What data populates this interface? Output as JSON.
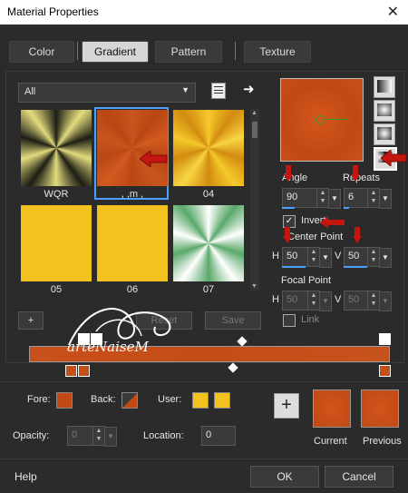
{
  "window": {
    "title": "Material Properties",
    "close": "✕"
  },
  "tabs": [
    {
      "label": "Color",
      "active": false
    },
    {
      "label": "Gradient",
      "active": true
    },
    {
      "label": "Pattern",
      "active": false
    },
    {
      "label": "Texture",
      "active": false
    }
  ],
  "filter": {
    "value": "All"
  },
  "gradients": [
    {
      "label": "WQR"
    },
    {
      "label": ", ,m ,"
    },
    {
      "label": "04"
    },
    {
      "label": "05"
    },
    {
      "label": "06"
    },
    {
      "label": "07"
    }
  ],
  "params": {
    "angle_label": "Angle",
    "angle_value": "90",
    "repeats_label": "Repeats",
    "repeats_value": "6",
    "invert_label": "Invert",
    "invert_checked": true,
    "center_point_label": "Center Point",
    "center_h_label": "H",
    "center_h_value": "50",
    "center_v_label": "V",
    "center_v_value": "50",
    "focal_point_label": "Focal Point",
    "focal_h_label": "H",
    "focal_h_value": "50",
    "focal_v_label": "V",
    "focal_v_value": "50",
    "link_label": "Link"
  },
  "list_buttons": {
    "add": "+",
    "reset": "Reset",
    "save": "Save"
  },
  "editor": {
    "fore_label": "Fore:",
    "back_label": "Back:",
    "user_label": "User:",
    "opacity_label": "Opacity:",
    "opacity_value": "0",
    "location_label": "Location:",
    "location_value": "0"
  },
  "previews": {
    "add": "+",
    "current": "Current",
    "previous": "Previous"
  },
  "footer": {
    "help": "Help",
    "ok": "OK",
    "cancel": "Cancel"
  },
  "watermark": {
    "text": "arteNaiseM"
  },
  "colors": {
    "accent": "#4aa0ff",
    "rust": "#c4501a",
    "yellow": "#f2c21f",
    "arrow": "#c4150f"
  }
}
